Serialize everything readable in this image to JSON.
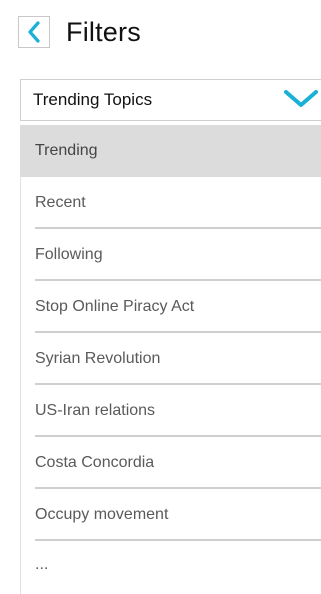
{
  "header": {
    "title": "Filters",
    "back_icon": "chevron-left-icon"
  },
  "dropdown": {
    "selected_label": "Trending Topics",
    "chevron_icon": "chevron-down-icon"
  },
  "colors": {
    "accent": "#1ab0d8",
    "selected_background": "#dcdcdc",
    "divider": "#cfcfcf"
  },
  "list": {
    "items": [
      {
        "label": "Trending",
        "selected": true
      },
      {
        "label": "Recent"
      },
      {
        "label": "Following"
      },
      {
        "label": "Stop Online Piracy Act"
      },
      {
        "label": "Syrian Revolution"
      },
      {
        "label": "US-Iran relations"
      },
      {
        "label": "Costa Concordia"
      },
      {
        "label": "Occupy movement"
      },
      {
        "label": "..."
      }
    ]
  }
}
